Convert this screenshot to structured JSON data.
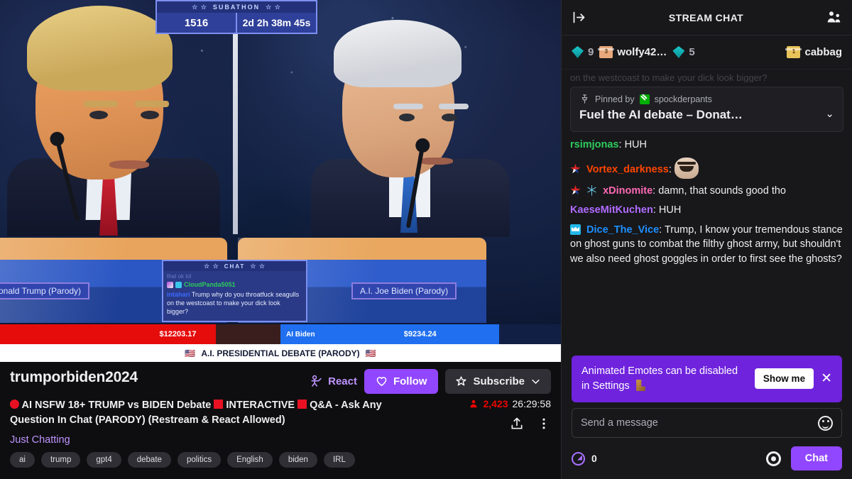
{
  "video": {
    "subathon": {
      "label": "SUBATHON",
      "stars_left": "☆ ☆",
      "stars_right": "☆ ☆",
      "count": "1516",
      "timer": "2d 2h 38m 45s"
    },
    "overlay_chat": {
      "label": "CHAT",
      "ghost_line": "that ok lol",
      "username": "CloudPanda5051",
      "question_user": "intahari",
      "question": "Trump why do you throatfuck seagulls on the westcoast to make your dick look bigger?"
    },
    "nameplate_left": "onald Trump (Parody)",
    "nameplate_right": "A.I. Joe Biden (Parody)",
    "bar_left_amount": "$12203.17",
    "bar_right_label": "AI Biden",
    "bar_right_amount": "$9234.24",
    "banner_text": "A.I. PRESIDENTIAL DEBATE (PARODY)",
    "banner_flag": "🇺🇸"
  },
  "info": {
    "channel": "trumporbiden2024",
    "title_part1": "AI NSFW 18+ TRUMP vs BIDEN Debate",
    "title_part2": "INTERACTIVE",
    "title_part3": "Q&A - Ask Any Question In Chat (PARODY) (Restream & React Allowed)",
    "category": "Just Chatting",
    "viewers": "2,423",
    "uptime": "26:29:58",
    "react_label": "React",
    "follow_label": "Follow",
    "subscribe_label": "Subscribe",
    "tags": [
      "ai",
      "trump",
      "gpt4",
      "debate",
      "politics",
      "English",
      "biden",
      "IRL"
    ]
  },
  "chat": {
    "title": "STREAM CHAT",
    "gifts": [
      {
        "type": "bits",
        "value": "9"
      },
      {
        "type": "gift",
        "count": "3",
        "name": "wolfy42…",
        "color": "peach"
      },
      {
        "type": "bits",
        "value": "5"
      },
      {
        "type": "gift",
        "count": "1",
        "name": "cabbag",
        "color": "gold"
      }
    ],
    "ghost_message": "on the westcoast to make your dick look bigger?",
    "pinned": {
      "pinned_by_label": "Pinned by",
      "pinned_by_user": "spockderpants",
      "text": "Fuel the AI debate – Donat…"
    },
    "messages": [
      {
        "badges": [],
        "user": "rsimjonas",
        "color": "#2ecb5c",
        "text": "HUH"
      },
      {
        "badges": [
          "star"
        ],
        "user": "Vortex_darkness",
        "color": "#ff4500",
        "text": "",
        "emote": "laughing-man"
      },
      {
        "badges": [
          "star",
          "snow"
        ],
        "user": "xDinomite",
        "color": "#ff69b4",
        "text": "damn, that sounds good tho"
      },
      {
        "badges": [],
        "user": "KaeseMitKuchen",
        "color": "#b06bff",
        "text": "HUH"
      },
      {
        "badges": [
          "vip"
        ],
        "user": "Dice_The_Vice",
        "color": "#1e90ff",
        "text": "Trump, I know your tremendous stance on ghost guns to combat the filthy ghost army, but shouldn't we also need ghost goggles in order to first see the ghosts?"
      }
    ],
    "notice": {
      "text": "Animated Emotes can be disabled in Settings",
      "button": "Show me",
      "close": "✕"
    },
    "composer": {
      "placeholder": "Send a message",
      "bits_balance": "0",
      "send_label": "Chat"
    }
  },
  "colors": {
    "accent": "#9147ff",
    "live": "#eb0400",
    "notice_bg": "#6f23dd"
  }
}
